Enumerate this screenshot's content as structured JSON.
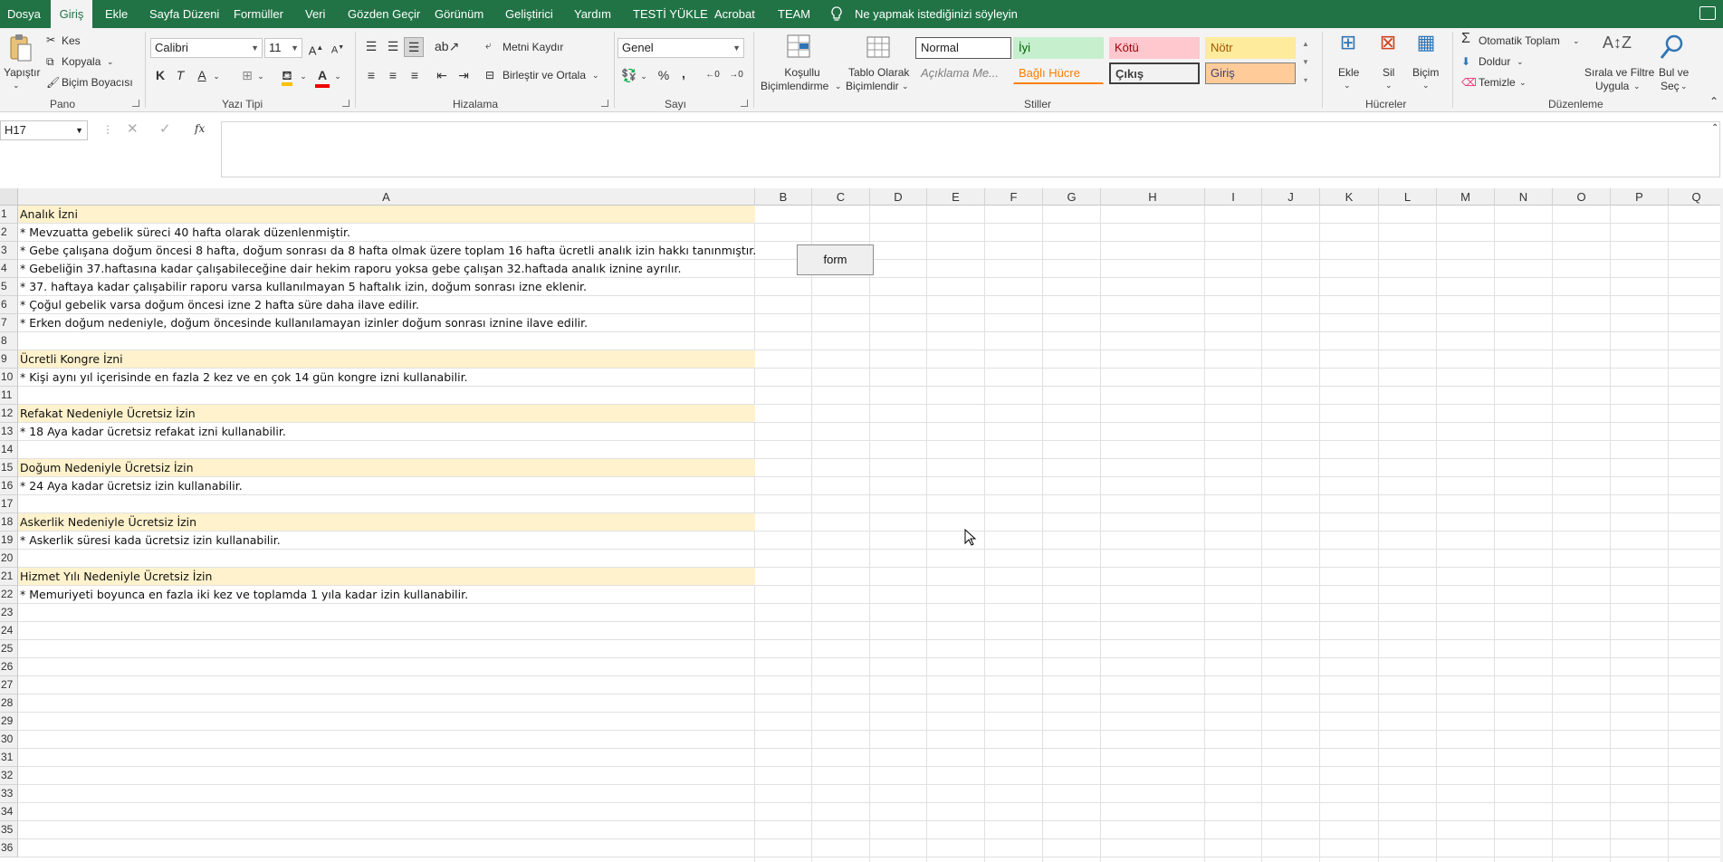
{
  "tabs": [
    "Dosya",
    "Giriş",
    "Ekle",
    "Sayfa Düzeni",
    "Formüller",
    "Veri",
    "Gözden Geçir",
    "Görünüm",
    "Geliştirici",
    "Yardım",
    "TESTİ YÜKLE",
    "Acrobat",
    "TEAM"
  ],
  "tell_me": "Ne yapmak istediğinizi söyleyin",
  "ribbon": {
    "clipboard": {
      "paste": "Yapıştır",
      "cut": "Kes",
      "copy": "Kopyala",
      "format_painter": "Biçim Boyacısı",
      "group": "Pano"
    },
    "font": {
      "name": "Calibri",
      "size": "11",
      "bold": "K",
      "italic": "T",
      "underline": "A",
      "color_a": "A",
      "group": "Yazı Tipi"
    },
    "alignment": {
      "wrap": "Metni Kaydır",
      "merge": "Birleştir ve Ortala",
      "group": "Hizalama"
    },
    "number": {
      "format": "Genel",
      "percent": "%",
      "comma": ",",
      "group": "Sayı"
    },
    "styles": {
      "conditional": "Koşullu Biçimlendirme",
      "conditional_l1": "Koşullu",
      "conditional_l2": "Biçimlendirme",
      "table_l1": "Tablo Olarak",
      "table_l2": "Biçimlendir",
      "cells": [
        "Normal",
        "İyi",
        "Kötü",
        "Nötr",
        "Açıklama Me...",
        "Bağlı Hücre",
        "Çıkış",
        "Giriş"
      ],
      "group": "Stiller"
    },
    "cells_group": {
      "insert": "Ekle",
      "delete": "Sil",
      "format": "Biçim",
      "group": "Hücreler"
    },
    "editing": {
      "autosum": "Otomatik Toplam",
      "fill": "Doldur",
      "clear": "Temizle",
      "sort_l1": "Sırala ve Filtre",
      "sort_l2": "Uygula",
      "find_l1": "Bul ve",
      "find_l2": "Seç",
      "group": "Düzenleme"
    }
  },
  "name_box": "H17",
  "columns": [
    "A",
    "B",
    "C",
    "D",
    "E",
    "F",
    "G",
    "H",
    "I",
    "J",
    "K",
    "L",
    "M",
    "N",
    "O",
    "P",
    "Q"
  ],
  "rows": [
    {
      "n": "1",
      "a": "Analık İzni",
      "hl": true
    },
    {
      "n": "2",
      "a": "* Mevzuatta gebelik süreci 40 hafta olarak düzenlenmiştir.",
      "hl": false
    },
    {
      "n": "3",
      "a": "* Gebe çalışana doğum öncesi 8 hafta, doğum sonrası da 8 hafta olmak üzere toplam 16 hafta ücretli analık izin hakkı  tanınmıştır.",
      "hl": false
    },
    {
      "n": "4",
      "a": "* Gebeliğin 37.haftasına kadar çalışabileceğine dair hekim raporu yoksa gebe çalışan 32.haftada analık iznine ayrılır.",
      "hl": false
    },
    {
      "n": "5",
      "a": "* 37. haftaya kadar çalışabilir raporu varsa kullanılmayan 5 haftalık izin, doğum sonrası izne eklenir.",
      "hl": false
    },
    {
      "n": "6",
      "a": "* Çoğul gebelik varsa doğum öncesi izne 2 hafta süre daha ilave edilir.",
      "hl": false
    },
    {
      "n": "7",
      "a": "* Erken doğum nedeniyle, doğum öncesinde kullanılamayan  izinler doğum sonrası iznine ilave edilir.",
      "hl": false
    },
    {
      "n": "8",
      "a": "",
      "hl": false
    },
    {
      "n": "9",
      "a": "Ücretli Kongre İzni",
      "hl": true
    },
    {
      "n": "10",
      "a": "* Kişi aynı yıl içerisinde en fazla 2 kez ve  en çok 14 gün kongre izni kullanabilir.",
      "hl": false
    },
    {
      "n": "11",
      "a": "",
      "hl": false
    },
    {
      "n": "12",
      "a": "Refakat Nedeniyle Ücretsiz İzin",
      "hl": true
    },
    {
      "n": "13",
      "a": "* 18 Aya kadar ücretsiz refakat izni kullanabilir.",
      "hl": false
    },
    {
      "n": "14",
      "a": "",
      "hl": false
    },
    {
      "n": "15",
      "a": "Doğum Nedeniyle Ücretsiz İzin",
      "hl": true
    },
    {
      "n": "16",
      "a": "* 24 Aya kadar ücretsiz izin kullanabilir.",
      "hl": false
    },
    {
      "n": "17",
      "a": "",
      "hl": false
    },
    {
      "n": "18",
      "a": "Askerlik Nedeniyle Ücretsiz İzin",
      "hl": true
    },
    {
      "n": "19",
      "a": "* Askerlik süresi kada ücretsiz izin kullanabilir.",
      "hl": false
    },
    {
      "n": "20",
      "a": "",
      "hl": false
    },
    {
      "n": "21",
      "a": "Hizmet Yılı Nedeniyle Ücretsiz İzin",
      "hl": true
    },
    {
      "n": "22",
      "a": "* Memuriyeti boyunca en fazla iki kez ve toplamda 1 yıla kadar izin kullanabilir.",
      "hl": false
    },
    {
      "n": "23",
      "a": "",
      "hl": false
    },
    {
      "n": "24",
      "a": "",
      "hl": false
    },
    {
      "n": "25",
      "a": "",
      "hl": false
    },
    {
      "n": "26",
      "a": "",
      "hl": false
    },
    {
      "n": "27",
      "a": "",
      "hl": false
    },
    {
      "n": "28",
      "a": "",
      "hl": false
    },
    {
      "n": "29",
      "a": "",
      "hl": false
    },
    {
      "n": "30",
      "a": "",
      "hl": false
    },
    {
      "n": "31",
      "a": "",
      "hl": false
    },
    {
      "n": "32",
      "a": "",
      "hl": false
    },
    {
      "n": "33",
      "a": "",
      "hl": false
    },
    {
      "n": "34",
      "a": "",
      "hl": false
    },
    {
      "n": "35",
      "a": "",
      "hl": false
    },
    {
      "n": "36",
      "a": "",
      "hl": false
    }
  ],
  "form_button": "form",
  "colors": {
    "excel_green": "#217346",
    "header_fill": "#fff2cc"
  }
}
